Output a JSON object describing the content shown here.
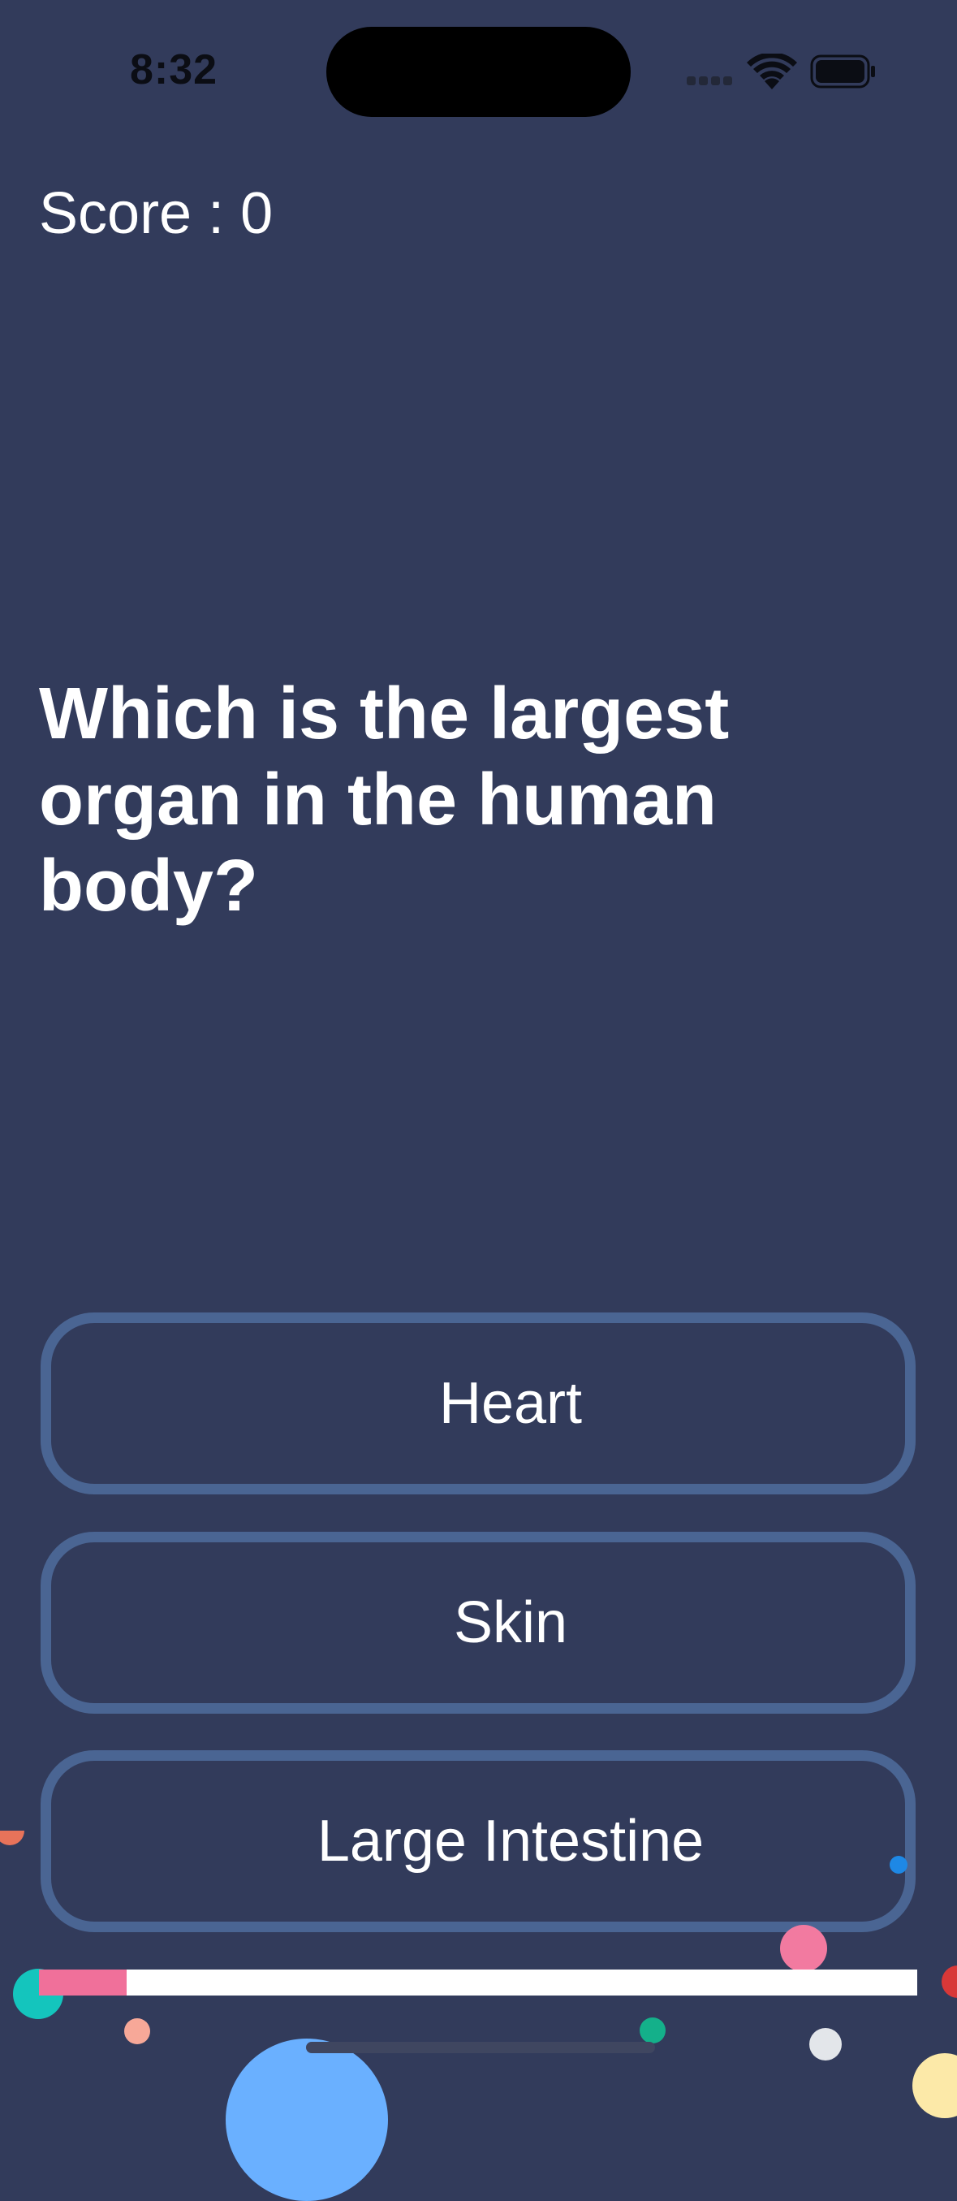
{
  "status_bar": {
    "time": "8:32"
  },
  "score": {
    "label": "Score : 0"
  },
  "question": {
    "text": "Which is the largest organ in the human body?"
  },
  "answers": [
    {
      "label": "Heart"
    },
    {
      "label": "Skin"
    },
    {
      "label": "Large Intestine"
    }
  ],
  "progress": {
    "fraction": 0.1
  },
  "colors": {
    "background": "#323b5b",
    "answer_border": "#4a6593",
    "progress_fill": "#f0709a",
    "progress_track": "#ffffff"
  },
  "icons": {
    "wifi": "wifi-icon",
    "battery": "battery-icon",
    "signal": "cellular-signal-icon"
  }
}
